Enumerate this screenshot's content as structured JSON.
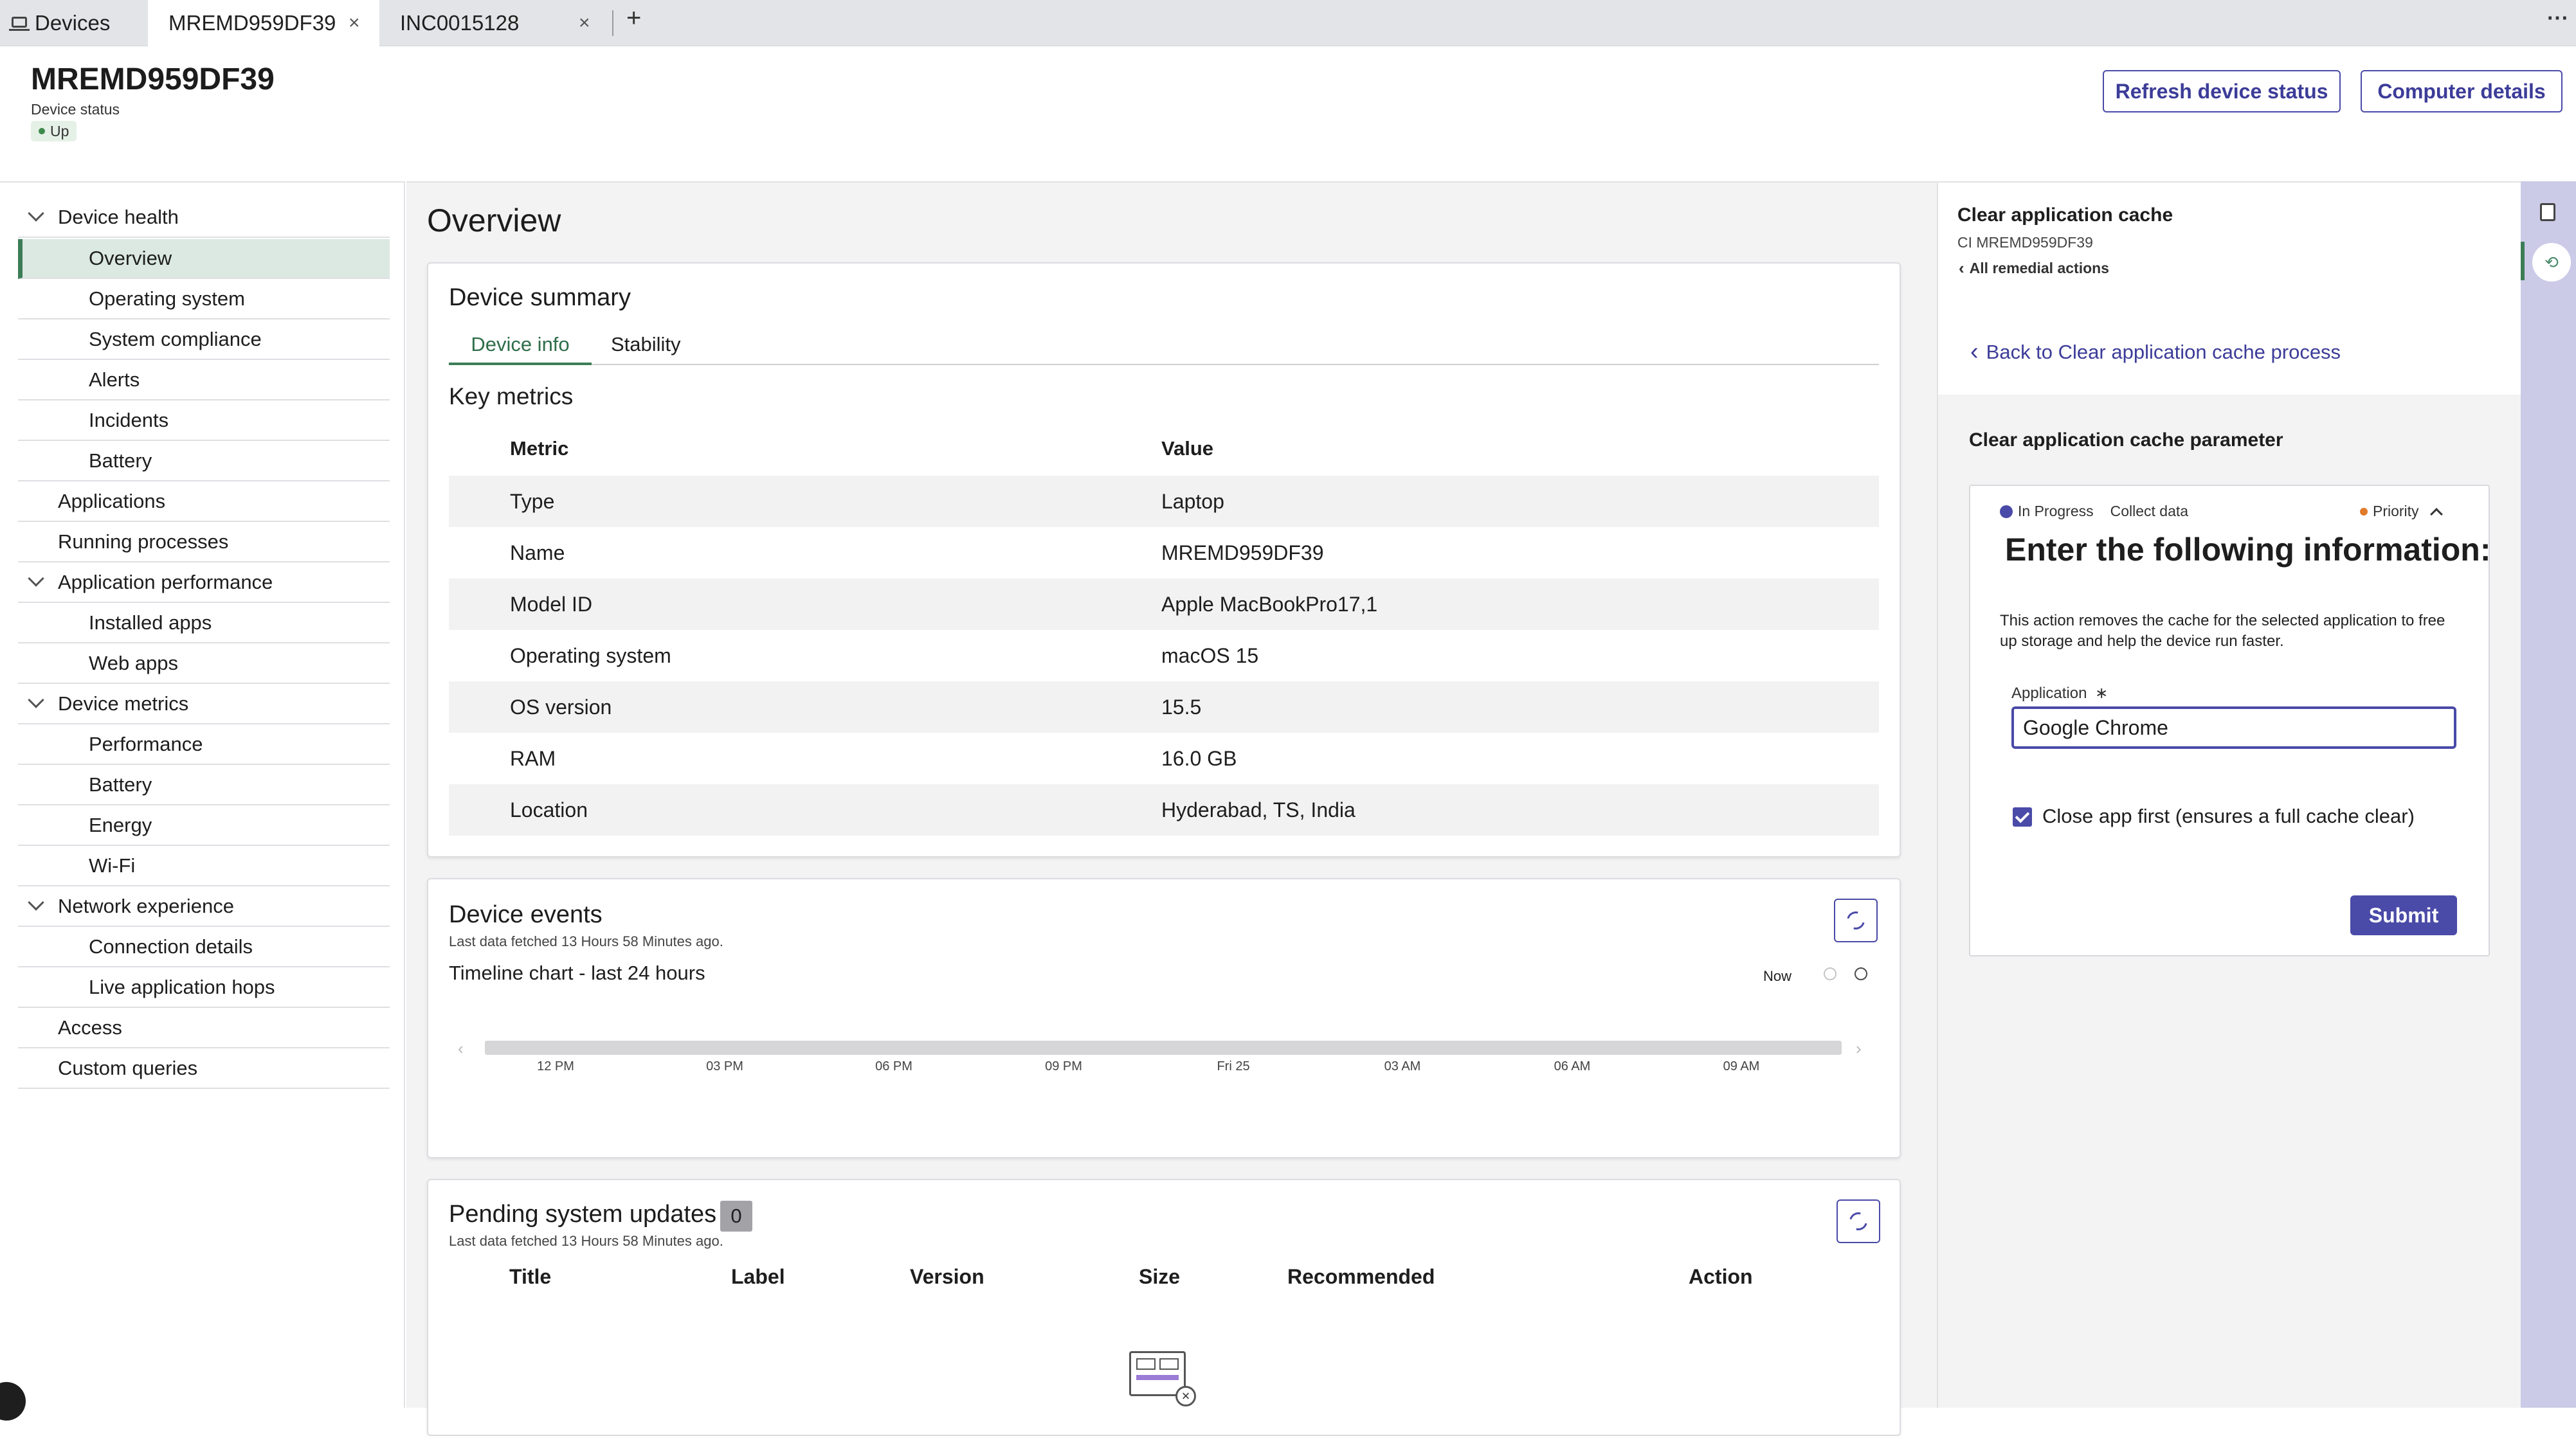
{
  "tabs": [
    {
      "label": "Devices",
      "icon": "laptop-icon"
    },
    {
      "label": "MREMD959DF39",
      "close": "×"
    },
    {
      "label": "INC0015128",
      "close": "×"
    }
  ],
  "tabbar": {
    "add": "+",
    "more": "⋯"
  },
  "header": {
    "title": "MREMD959DF39",
    "status_label": "Device status",
    "status_value": "Up",
    "refresh_button": "Refresh device status",
    "details_button": "Computer details"
  },
  "nav": {
    "items": [
      {
        "label": "Device health",
        "level": 0,
        "expanded": true
      },
      {
        "label": "Overview",
        "level": 1,
        "selected": true
      },
      {
        "label": "Operating system",
        "level": 1
      },
      {
        "label": "System compliance",
        "level": 1
      },
      {
        "label": "Alerts",
        "level": 1
      },
      {
        "label": "Incidents",
        "level": 1
      },
      {
        "label": "Battery",
        "level": 1
      },
      {
        "label": "Applications",
        "level": 0
      },
      {
        "label": "Running processes",
        "level": 0
      },
      {
        "label": "Application performance",
        "level": 0,
        "expanded": true
      },
      {
        "label": "Installed apps",
        "level": 1
      },
      {
        "label": "Web apps",
        "level": 1
      },
      {
        "label": "Device metrics",
        "level": 0,
        "expanded": true
      },
      {
        "label": "Performance",
        "level": 1
      },
      {
        "label": "Battery",
        "level": 1
      },
      {
        "label": "Energy",
        "level": 1
      },
      {
        "label": "Wi-Fi",
        "level": 1
      },
      {
        "label": "Network experience",
        "level": 0,
        "expanded": true
      },
      {
        "label": "Connection details",
        "level": 1
      },
      {
        "label": "Live application hops",
        "level": 1
      },
      {
        "label": "Access",
        "level": 0
      },
      {
        "label": "Custom queries",
        "level": 0
      }
    ]
  },
  "main": {
    "title": "Overview",
    "summary": {
      "title": "Device summary",
      "tabs": [
        "Device info",
        "Stability"
      ],
      "key_metrics_title": "Key metrics",
      "col_metric": "Metric",
      "col_value": "Value",
      "rows": [
        {
          "metric": "Type",
          "value": "Laptop"
        },
        {
          "metric": "Name",
          "value": "MREMD959DF39"
        },
        {
          "metric": "Model ID",
          "value": "Apple MacBookPro17,1"
        },
        {
          "metric": "Operating system",
          "value": "macOS 15"
        },
        {
          "metric": "OS version",
          "value": "15.5"
        },
        {
          "metric": "RAM",
          "value": "16.0 GB"
        },
        {
          "metric": "Location",
          "value": "Hyderabad, TS, India"
        }
      ]
    },
    "events": {
      "title": "Device events",
      "fetched": "Last data fetched 13 Hours 58 Minutes ago.",
      "timeline_title": "Timeline chart - last 24 hours",
      "now_label": "Now",
      "ticks": [
        "12 PM",
        "03 PM",
        "06 PM",
        "09 PM",
        "Fri 25",
        "03 AM",
        "06 AM",
        "09 AM"
      ]
    },
    "updates": {
      "title": "Pending system updates",
      "count": "0",
      "fetched": "Last data fetched 13 Hours 58 Minutes ago.",
      "columns": [
        "Title",
        "Label",
        "Version",
        "Size",
        "Recommended",
        "Action"
      ]
    }
  },
  "panel": {
    "title": "Clear application cache",
    "ci": "CI MREMD959DF39",
    "all_actions": "All remedial actions",
    "back_link": "Back to Clear application cache process",
    "param_title": "Clear application cache parameter",
    "state": "In Progress",
    "step": "Collect data",
    "priority": "Priority",
    "form_heading": "Enter the following information:",
    "description": "This action removes the cache for the selected application to free up storage and help the device run faster.",
    "app_label": "Application",
    "required_mark": "∗",
    "app_value": "Google Chrome",
    "checkbox_label": "Close app first (ensures a full cache clear)",
    "checkbox_checked": true,
    "submit": "Submit"
  },
  "colors": {
    "accent": "#4a4aa8",
    "selected_nav": "#dbe9e2",
    "status_up": "#3f8a4c",
    "priority_dot": "#e07b2a",
    "rail": "#cbcbe8"
  }
}
